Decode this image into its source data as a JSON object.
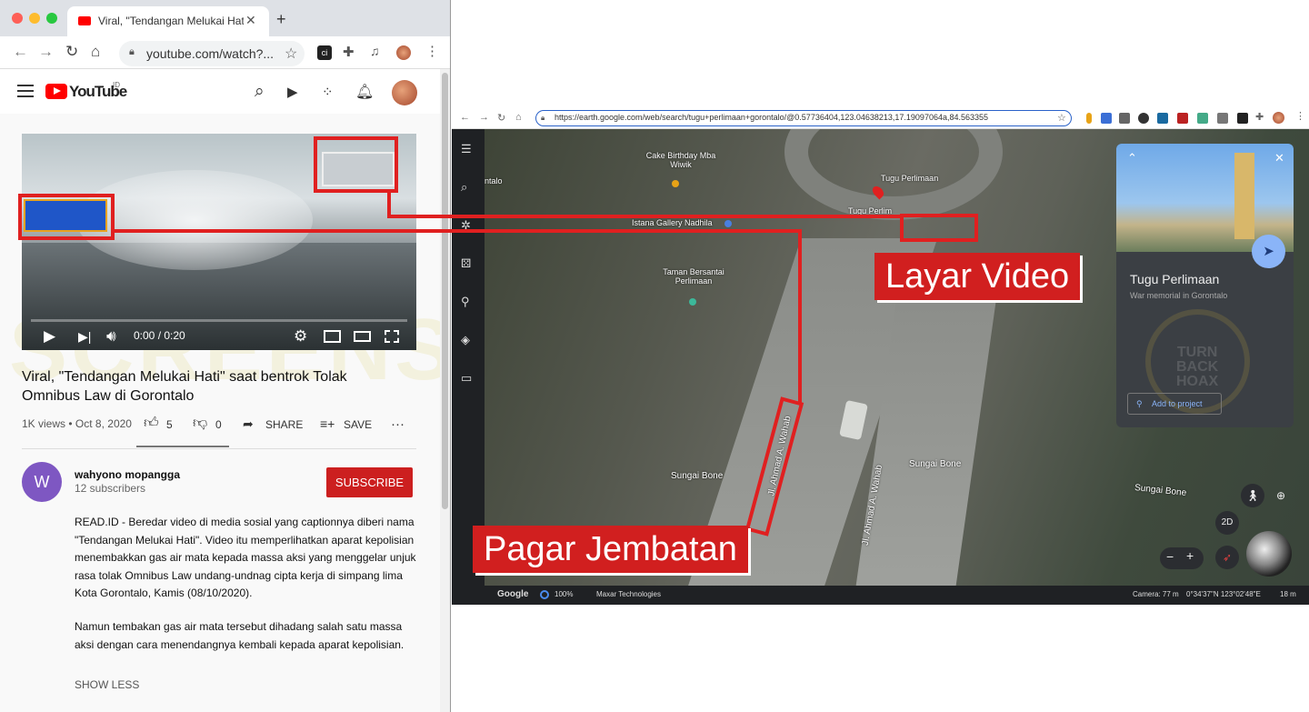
{
  "browser_left": {
    "tab_title": "Viral, \"Tendangan Melukai Hati\"",
    "tab_close": "✕",
    "new_tab": "+",
    "url": "youtube.com/watch?...",
    "ext_ci": "ci"
  },
  "youtube": {
    "logo_text": "YouTube",
    "region": "ID",
    "player": {
      "time": "0:00 / 0:20",
      "progress": 0
    },
    "video_title": "Viral, \"Tendangan Melukai Hati\" saat bentrok Tolak Omnibus Law di Gorontalo",
    "views": "1K views",
    "date": "Oct 8, 2020",
    "likes": "5",
    "dislikes": "0",
    "share": "SHARE",
    "save": "SAVE",
    "more": "···",
    "channel": {
      "initial": "W",
      "name": "wahyono mopangga",
      "subscribers": "12 subscribers"
    },
    "subscribe": "SUBSCRIBE",
    "description": [
      "READ.ID - Beredar video di media sosial yang captionnya diberi nama \"Tendangan Melukai Hati\". Video itu memperlihatkan aparat kepolisian menembakkan gas air mata kepada massa aksi yang menggelar unjuk rasa tolak Omnibus Law undang-undnag cipta kerja di simpang lima Kota Gorontalo, Kamis (08/10/2020).",
      "Namun tembakan gas air mata tersebut dihadang salah satu massa aksi dengan cara menendangnya kembali kepada aparat kepolisian."
    ],
    "show_less": "SHOW LESS"
  },
  "watermark": "SCREENSHOOTER",
  "browser_right": {
    "url": "https://earth.google.com/web/search/tugu+perlimaan+gorontalo/@0.57736404,123.04638213,17.19097064a,84.563355"
  },
  "earth": {
    "labels": {
      "cake": "Cake Birthday Mba Wiwik",
      "istana": "Istana Gallery Nadhila",
      "taman": "Taman Bersantai Perlimaan",
      "tugu": "Tugu Perlimaan",
      "tugu2": "Tugu Perlim",
      "talo": "ntalo",
      "sungai1": "Sungai Bone",
      "sungai2": "Sungai Bone",
      "sungai3": "Sungai Bone",
      "jl1": "Jl. Ahmad A. Wahab",
      "jl2": "Jl. Ahmad A. Wahab"
    },
    "panel": {
      "title": "Tugu Perlimaan",
      "subtitle": "War memorial in Gorontalo",
      "add_project": "Add to project"
    },
    "footer": {
      "google": "Google",
      "zoom": "100%",
      "provider": "Maxar Technologies",
      "camera": "Camera: 77 m",
      "coords": "0°34'37\"N 123°02'48\"E",
      "scale": "18 m"
    },
    "btn_2d": "2D",
    "zoom_minus": "−",
    "zoom_plus": "+"
  },
  "annotations": {
    "screen": "Layar Video",
    "fence": "Pagar Jembatan"
  },
  "panel_badge": {
    "line1": "TURN",
    "line2": "BACK",
    "line3": "HOAX"
  },
  "colors": {
    "annotation_red": "#d11f1f",
    "youtube_red": "#ff0000",
    "subscribe": "#cc1f1f",
    "earth_accent": "#8ab4f8"
  }
}
